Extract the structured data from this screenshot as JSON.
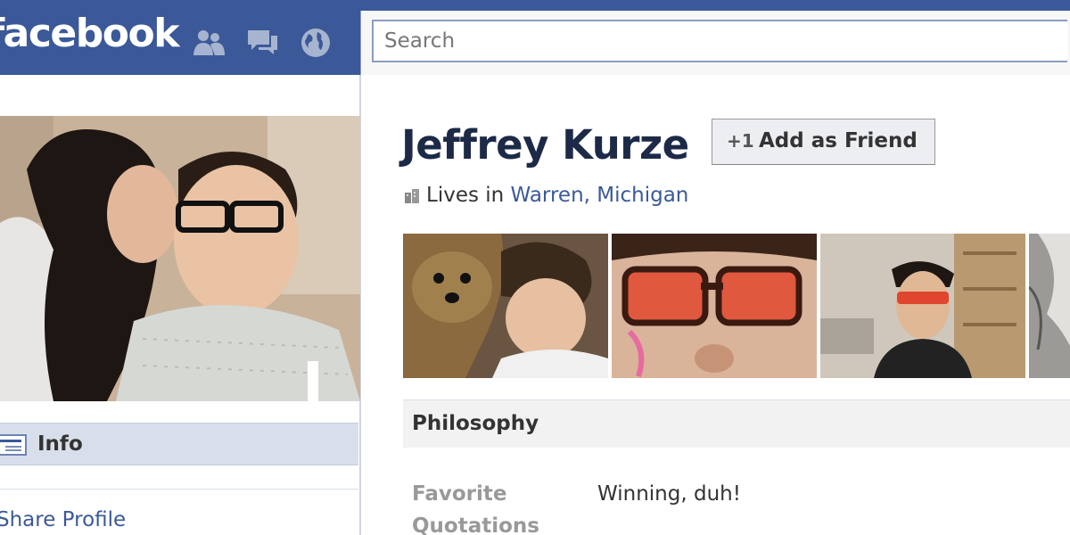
{
  "header": {
    "logo": "facebook",
    "search_placeholder": "Search",
    "jewels": [
      "friend-requests-icon",
      "messages-icon",
      "notifications-globe-icon"
    ]
  },
  "left_column": {
    "nav_info_label": "Info",
    "share_profile": "Share Profile"
  },
  "profile": {
    "name": "Jeffrey Kurze",
    "add_friend_icon": "+1",
    "add_friend_label": "Add as Friend",
    "lives_prefix": "Lives in",
    "location": "Warren, Michigan"
  },
  "sections": {
    "philosophy_title": "Philosophy",
    "favorite_quotations_label": "Favorite Quotations",
    "favorite_quotations_value": "Winning, duh!"
  },
  "colors": {
    "brand_blue": "#3b5998",
    "name_color": "#1c2a47",
    "link_color": "#3b5998"
  }
}
